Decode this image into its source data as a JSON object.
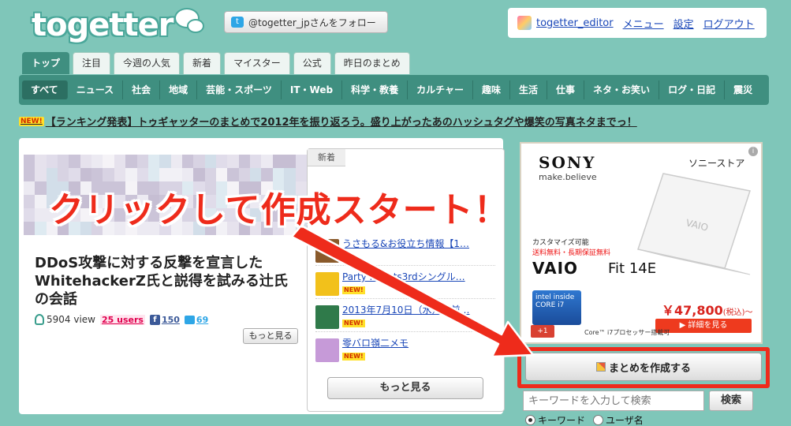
{
  "logo": {
    "text": "togetter"
  },
  "follow": {
    "label": "@togetter_jpさんをフォロー"
  },
  "user": {
    "name": "togetter_editor",
    "menu": "メニュー",
    "settings": "設定",
    "logout": "ログアウト"
  },
  "tabs": [
    "トップ",
    "注目",
    "今週の人気",
    "新着",
    "マイスター",
    "公式",
    "昨日のまとめ"
  ],
  "categories": [
    "すべて",
    "ニュース",
    "社会",
    "地域",
    "芸能・スポーツ",
    "IT・Web",
    "科学・教養",
    "カルチャー",
    "趣味",
    "生活",
    "仕事",
    "ネタ・お笑い",
    "ログ・日記",
    "震災"
  ],
  "news": {
    "badge": "NEW!",
    "text": "【ランキング発表】トゥギャッターのまとめで2012年を振り返ろう。盛り上がったあのハッシュタグや爆笑の写真ネタまでっ！"
  },
  "article": {
    "title": "DDoS攻撃に対する反撃を宣言したWhitehackerZ氏と説得を試みる辻氏の会話",
    "views": "5904 view",
    "users": "25 users",
    "fb_count": "150",
    "tw_count": "69",
    "more_label": "もっと見る"
  },
  "side": {
    "header": "新着",
    "badge": "NEW!",
    "items": [
      {
        "title": "うさもる&お役立ち情報【1…",
        "color": "#8a5a2b"
      },
      {
        "title": "Party Robots3rdシングル…",
        "color": "#f2c11b"
      },
      {
        "title": "2013年7月10日（水）午前…",
        "color": "#2f7a4a"
      },
      {
        "title": "零バロ嶺二メモ",
        "color": "#c69ad8"
      }
    ],
    "more_label": "もっと見る"
  },
  "ad": {
    "brand": "SONY",
    "tagline": "make.believe",
    "store": "ソニーストア",
    "custom": "カスタマイズ可能",
    "free": "送料無料・長期保証無料",
    "product": "VAIO",
    "model": "Fit 14E",
    "intel": "intel inside CORE i7",
    "price": "￥47,800",
    "price_note": "(税込)～",
    "detail": "▶ 詳細を見る",
    "gplus": "+1",
    "core_note": "Core™ i7プロセッサー搭載可"
  },
  "create": {
    "label": "まとめを作成する"
  },
  "search": {
    "placeholder": "キーワードを入力して検索",
    "button": "検索",
    "opt_keyword": "キーワード",
    "opt_user": "ユーザ名"
  },
  "overlay": {
    "text": "クリックして作成スタート！"
  },
  "colors": {
    "bg": "#7fc6b9",
    "nav": "#3f8f80",
    "highlight": "#ee2b1b"
  }
}
